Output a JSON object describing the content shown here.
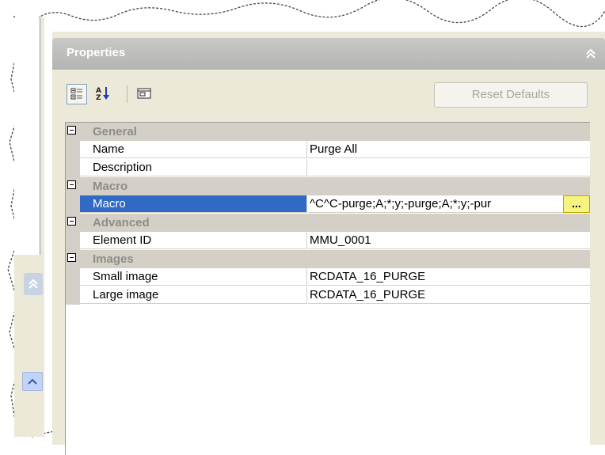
{
  "palette": {
    "title": "Properties",
    "toolbar": {
      "reset_label": "Reset Defaults"
    },
    "rows": [
      {
        "type": "category",
        "label": "General"
      },
      {
        "type": "property",
        "name": "Name",
        "value": "Purge All"
      },
      {
        "type": "property",
        "name": "Description",
        "value": ""
      },
      {
        "type": "category",
        "label": "Macro"
      },
      {
        "type": "property",
        "name": "Macro",
        "value": "^C^C-purge;A;*;y;-purge;A;*;y;-pur",
        "selected": true
      },
      {
        "type": "category",
        "label": "Advanced"
      },
      {
        "type": "property",
        "name": "Element ID",
        "value": "MMU_0001"
      },
      {
        "type": "category",
        "label": "Images"
      },
      {
        "type": "property",
        "name": "Small image",
        "value": "RCDATA_16_PURGE"
      },
      {
        "type": "property",
        "name": "Large image",
        "value": "RCDATA_16_PURGE"
      }
    ],
    "ellipsis_label": "..."
  },
  "icons": {
    "categorized": "categorized-view-icon",
    "alphabetic": "alphabetic-sort-icon",
    "description": "description-panel-icon",
    "collapse": "double-chevron-up-icon"
  },
  "colors": {
    "selection": "#316ac5",
    "title_bar": "#b4b4b2",
    "category_bg": "#d4d0c8",
    "ellipsis_bg": "#f7f380"
  }
}
